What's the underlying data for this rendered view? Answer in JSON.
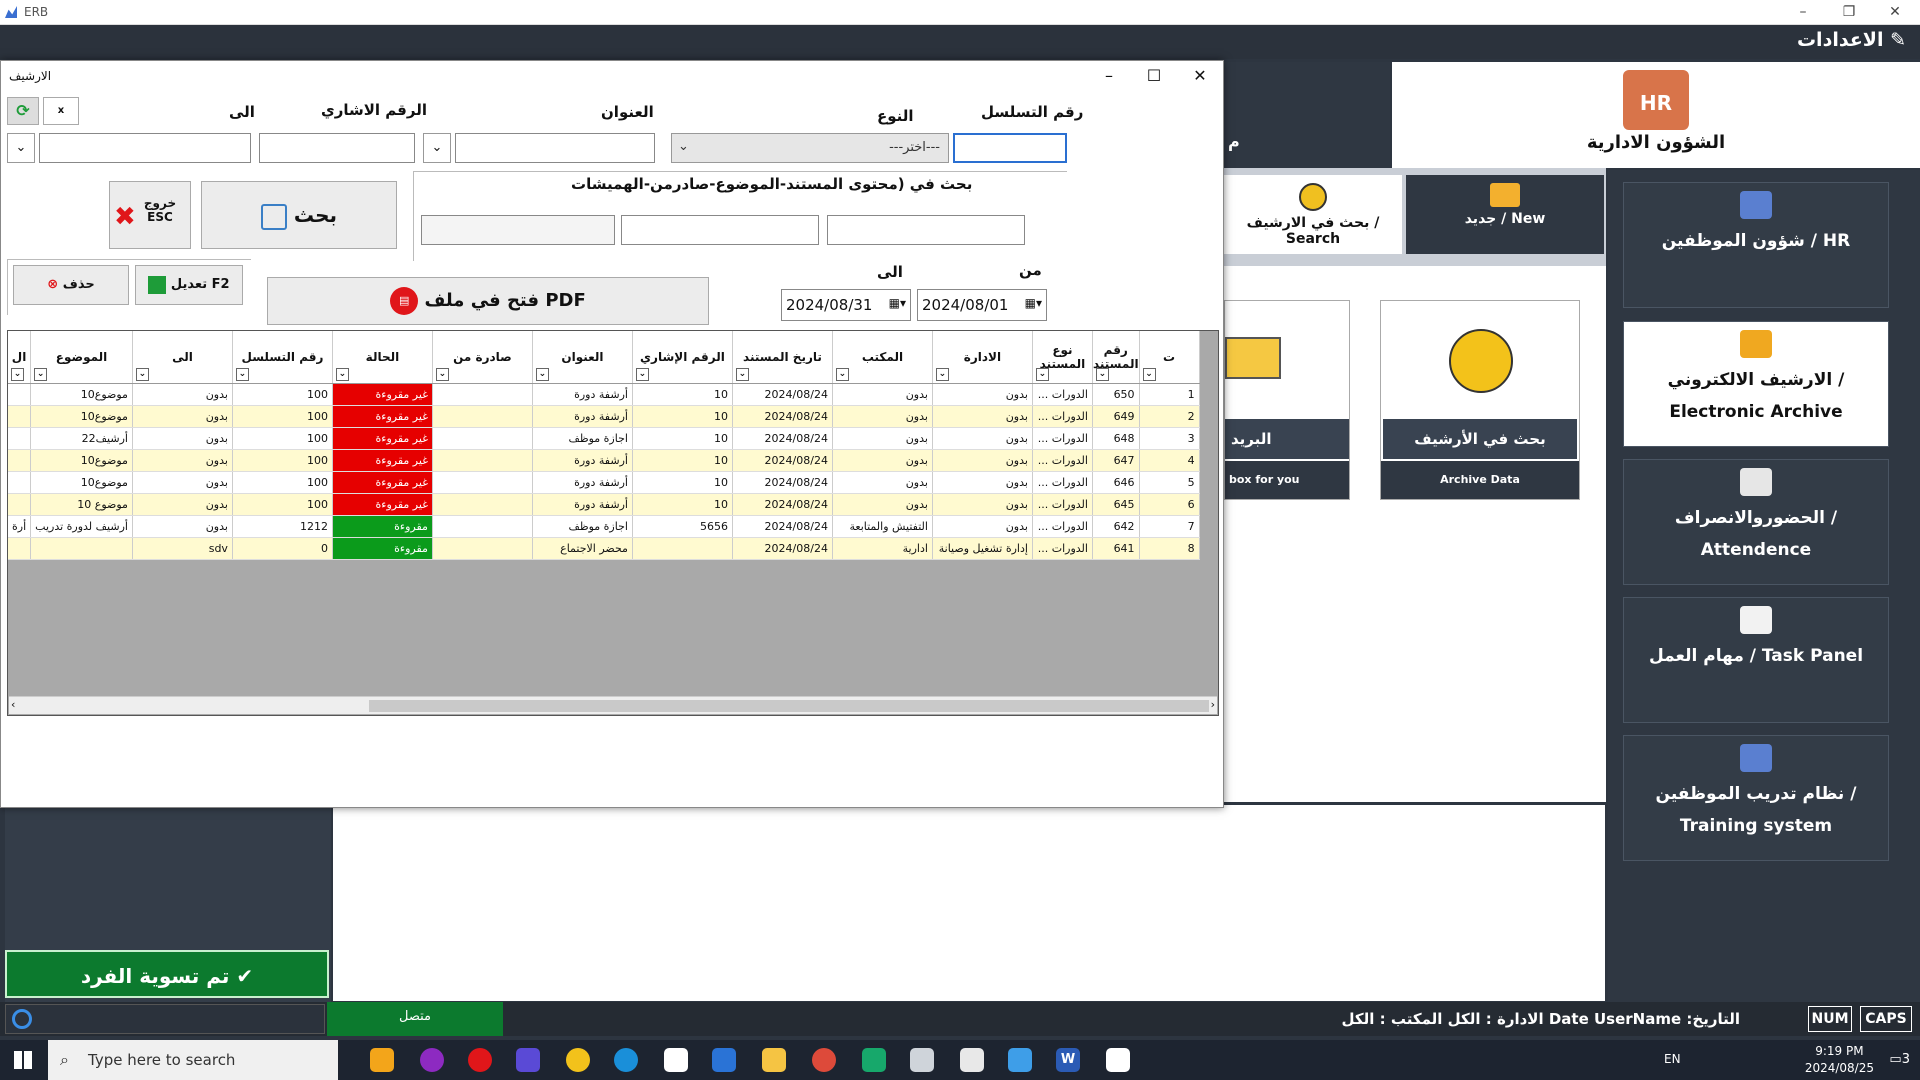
{
  "app": {
    "title": "ERB",
    "settings_label": "الاعدادات"
  },
  "hr_header": {
    "icon_text": "HR",
    "title": "الشؤون الادارية"
  },
  "sidebar": {
    "items": [
      {
        "label": "شؤون الموظفين / HR",
        "icon": "users-icon",
        "active": false
      },
      {
        "label": "الارشيف الالكتروني / Electronic Archive",
        "icon": "archive-icon",
        "active": true
      },
      {
        "label": "الحضوروالانصراف / Attendence",
        "icon": "attendance-icon",
        "active": false
      },
      {
        "label": "مهام العمل / Task Panel",
        "icon": "tasks-icon",
        "active": false
      },
      {
        "label": "نظام تدريب الموظفين / Training system",
        "icon": "training-icon",
        "active": false
      }
    ]
  },
  "middle": {
    "tab_new": "جديد / New",
    "tab_search": "بحث في الارشيف / Search",
    "tile_search_label": "بحث في الأرشيف",
    "tile_search_sub": "Archive Data",
    "tile_mail_label": "البريد",
    "tile_mail_sub": "box for you",
    "header_partial": "م"
  },
  "left": {
    "settle_label": "تم تسوية الفرد"
  },
  "statusbar": {
    "online": "متصل",
    "info": "التاريخ: Date  UserName  الادارة : الكل المكتب : الكل",
    "num": "NUM",
    "caps": "CAPS"
  },
  "taskbar": {
    "search_placeholder": "Type here to search",
    "lang": "EN",
    "time": "9:19 PM",
    "date": "2024/08/25",
    "notif_count": "3"
  },
  "dialog": {
    "title": "الارشيف",
    "labels": {
      "serial": "رقم التسلسل",
      "type": "النوع",
      "subject": "العنوان",
      "ref_no": "الرقم الاشاري",
      "to": "الى",
      "search_in": "بحث في (محتوى المستند-الموضوع-صادرمن-الهميشات",
      "from_date": "من",
      "to_date": "الى"
    },
    "type_value": "---اختر---",
    "from_date_value": "2024/08/01",
    "to_date_value": "2024/08/31",
    "buttons": {
      "search": "بحث",
      "exit": "خروج ESC",
      "edit": "تعديل F2",
      "delete": "حذف",
      "open_pdf": "فتح في ملف PDF"
    }
  },
  "grid": {
    "headers": [
      "ت",
      "رقم المستند",
      "نوع المستند",
      "الادارة",
      "المكتب",
      "تاريخ المستند",
      "الرقم الإشاري",
      "العنوان",
      "صادرة من",
      "الحالة",
      "رقم التسلسل",
      "الى",
      "الموضوع",
      "ال"
    ],
    "rows": [
      [
        "1",
        "650",
        "الدورات ...",
        "بدون",
        "بدون",
        "2024/08/24",
        "10",
        "أرشفة دورة",
        "",
        "غير مقروءة",
        "100",
        "بدون",
        "موضوع10",
        ""
      ],
      [
        "2",
        "649",
        "الدورات ...",
        "بدون",
        "بدون",
        "2024/08/24",
        "10",
        "أرشفة دورة",
        "",
        "غير مقروءة",
        "100",
        "بدون",
        "موضوع10",
        ""
      ],
      [
        "3",
        "648",
        "الدورات ...",
        "بدون",
        "بدون",
        "2024/08/24",
        "10",
        "اجازة موظف",
        "",
        "غير مقروءة",
        "100",
        "بدون",
        "أرشيف22",
        ""
      ],
      [
        "4",
        "647",
        "الدورات ...",
        "بدون",
        "بدون",
        "2024/08/24",
        "10",
        "أرشفة دورة",
        "",
        "غير مقروءة",
        "100",
        "بدون",
        "موضوع10",
        ""
      ],
      [
        "5",
        "646",
        "الدورات ...",
        "بدون",
        "بدون",
        "2024/08/24",
        "10",
        "أرشفة دورة",
        "",
        "غير مقروءة",
        "100",
        "بدون",
        "موضوع10",
        ""
      ],
      [
        "6",
        "645",
        "الدورات ...",
        "بدون",
        "بدون",
        "2024/08/24",
        "10",
        "أرشفة دورة",
        "",
        "غير مقروءة",
        "100",
        "بدون",
        "موضوع 10",
        ""
      ],
      [
        "7",
        "642",
        "الدورات ...",
        "بدون",
        "التفتيش والمتابعة",
        "2024/08/24",
        "5656",
        "اجازة موظف",
        "",
        "مقروءة",
        "1212",
        "بدون",
        "أرشيف لدورة تدريب",
        "أرة"
      ],
      [
        "8",
        "641",
        "الدورات ...",
        "إدارة تشغيل وصيانة",
        "ادارية",
        "2024/08/24",
        "",
        "محضر الاجتماع",
        "",
        "مقروءة",
        "0",
        "sdv",
        "",
        ""
      ]
    ],
    "row_status": [
      "red",
      "red",
      "red",
      "red",
      "red",
      "red",
      "green",
      "green"
    ]
  }
}
